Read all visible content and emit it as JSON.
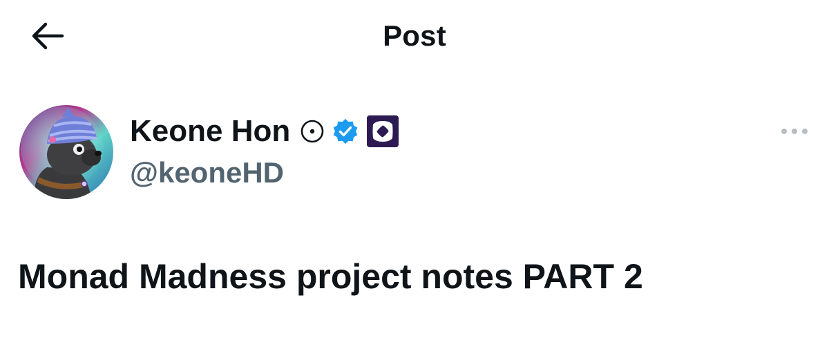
{
  "header": {
    "title": "Post",
    "back_icon": "arrow-left-icon"
  },
  "author": {
    "name": "Keone Hon",
    "handle": "@keoneHD",
    "badges": [
      "automated-circle-icon",
      "verified-check-icon",
      "affiliate-logo-icon"
    ],
    "verified_color": "#1d9bf0",
    "affiliate_color": "#2d1a52"
  },
  "post": {
    "text": "Monad Madness project notes PART 2"
  },
  "actions": {
    "more_icon": "more-horizontal-icon"
  },
  "colors": {
    "text_primary": "#0f1419",
    "text_secondary": "#536471",
    "background": "#ffffff"
  }
}
